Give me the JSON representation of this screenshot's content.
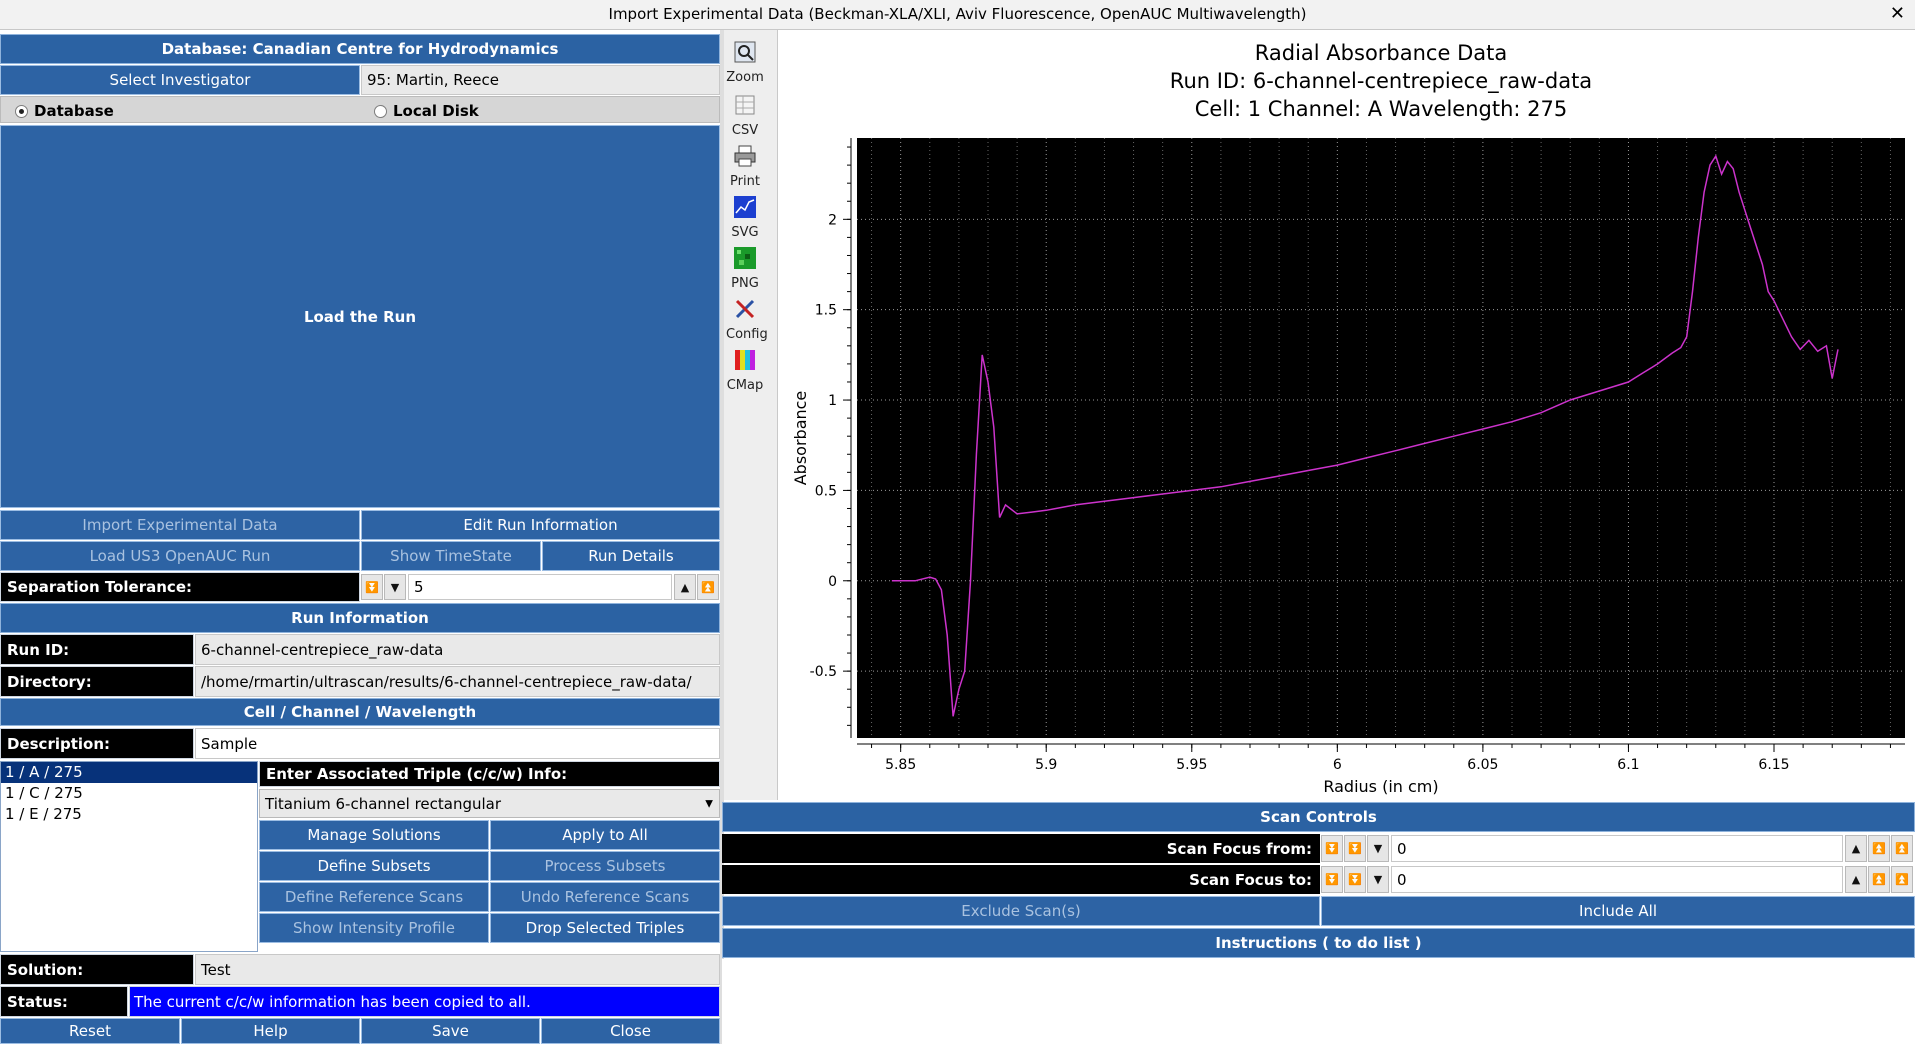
{
  "window": {
    "title": "Import Experimental Data (Beckman-XLA/XLI, Aviv Fluorescence, OpenAUC Multiwavelength)",
    "close_glyph": "✕"
  },
  "left": {
    "database_banner": "Database: Canadian Centre for Hydrodynamics",
    "select_investigator": "Select Investigator",
    "investigator_value": "95: Martin, Reece",
    "radio_database": "Database",
    "radio_local": "Local Disk",
    "load_run": "Load the Run",
    "import_data": "Import Experimental Data",
    "edit_run_info": "Edit Run Information",
    "load_openauc": "Load US3 OpenAUC Run",
    "show_timestate": "Show TimeState",
    "run_details": "Run Details",
    "sep_tol_label": "Separation Tolerance:",
    "sep_tol_value": "5",
    "run_info_banner": "Run Information",
    "run_id_label": "Run ID:",
    "run_id_value": "6-channel-centrepiece_raw-data",
    "directory_label": "Directory:",
    "directory_value": "/home/rmartin/ultrascan/results/6-channel-centrepiece_raw-data/",
    "ccw_banner": "Cell / Channel / Wavelength",
    "description_label": "Description:",
    "description_value": "Sample",
    "triples": [
      "1 / A / 275",
      "1 / C / 275",
      "1 / E / 275"
    ],
    "triple_info_label": "Enter Associated Triple (c/c/w) Info:",
    "centerpiece": "Titanium 6-channel rectangular",
    "manage_solutions": "Manage Solutions",
    "apply_to_all": "Apply to All",
    "define_subsets": "Define Subsets",
    "process_subsets": "Process Subsets",
    "define_ref_scans": "Define Reference Scans",
    "undo_ref_scans": "Undo Reference Scans",
    "show_intensity": "Show Intensity Profile",
    "drop_triples": "Drop Selected Triples",
    "solution_label": "Solution:",
    "solution_value": "Test",
    "status_label": "Status:",
    "status_value": "The current c/c/w information has been copied to all.",
    "reset": "Reset",
    "help": "Help",
    "save": "Save",
    "close": "Close"
  },
  "toolbar": {
    "items": [
      {
        "label": "Zoom",
        "icon": "zoom-icon"
      },
      {
        "label": "CSV",
        "icon": "csv-icon"
      },
      {
        "label": "Print",
        "icon": "print-icon"
      },
      {
        "label": "SVG",
        "icon": "svg-icon"
      },
      {
        "label": "PNG",
        "icon": "png-icon"
      },
      {
        "label": "Config",
        "icon": "config-icon"
      },
      {
        "label": "CMap",
        "icon": "cmap-icon"
      }
    ]
  },
  "chart_data": {
    "type": "line",
    "title": "Radial Absorbance Data",
    "subtitle": "Run ID: 6-channel-centrepiece_raw-data",
    "subtitle2": "Cell: 1  Channel: A  Wavelength: 275",
    "xlabel": "Radius (in cm)",
    "ylabel": "Absorbance",
    "xlim": [
      5.835,
      6.195
    ],
    "ylim": [
      -0.87,
      2.45
    ],
    "xticks": [
      5.85,
      5.9,
      5.95,
      6,
      6.05,
      6.1,
      6.15
    ],
    "xtick_labels": [
      "5.85",
      "5.9",
      "5.95",
      "6",
      "6.05",
      "6.1",
      "6.15"
    ],
    "yticks": [
      -0.5,
      0,
      0.5,
      1,
      1.5,
      2
    ],
    "ytick_labels": [
      "-0.5",
      "0",
      "0.5",
      "1",
      "1.5",
      "2"
    ],
    "grid": true,
    "background": "#000000",
    "line_color": "#cc33cc",
    "series": [
      {
        "x": [
          5.847,
          5.855,
          5.86,
          5.862,
          5.864,
          5.866,
          5.868,
          5.87,
          5.872,
          5.874,
          5.876,
          5.878,
          5.88,
          5.882,
          5.884,
          5.886,
          5.89,
          5.895,
          5.9,
          5.91,
          5.92,
          5.93,
          5.94,
          5.95,
          5.96,
          5.97,
          5.98,
          5.99,
          6.0,
          6.01,
          6.02,
          6.03,
          6.04,
          6.05,
          6.06,
          6.07,
          6.08,
          6.09,
          6.1,
          6.105,
          6.11,
          6.115,
          6.118,
          6.12,
          6.122,
          6.124,
          6.126,
          6.128,
          6.13,
          6.132,
          6.134,
          6.136,
          6.138,
          6.14,
          6.142,
          6.144,
          6.146,
          6.148,
          6.15,
          6.153,
          6.156,
          6.159,
          6.162,
          6.165,
          6.168,
          6.17,
          6.172
        ],
        "y": [
          0.0,
          0.0,
          0.02,
          0.01,
          -0.05,
          -0.3,
          -0.75,
          -0.6,
          -0.5,
          0.0,
          0.7,
          1.25,
          1.1,
          0.85,
          0.35,
          0.42,
          0.37,
          0.38,
          0.39,
          0.42,
          0.44,
          0.46,
          0.48,
          0.5,
          0.52,
          0.55,
          0.58,
          0.61,
          0.64,
          0.68,
          0.72,
          0.76,
          0.8,
          0.84,
          0.88,
          0.93,
          1.0,
          1.05,
          1.1,
          1.15,
          1.2,
          1.26,
          1.29,
          1.35,
          1.6,
          1.9,
          2.15,
          2.3,
          2.35,
          2.25,
          2.32,
          2.28,
          2.15,
          2.05,
          1.95,
          1.85,
          1.75,
          1.6,
          1.55,
          1.45,
          1.35,
          1.28,
          1.33,
          1.27,
          1.3,
          1.12,
          1.28
        ]
      }
    ]
  },
  "scan": {
    "banner": "Scan Controls",
    "focus_from_label": "Scan Focus from:",
    "focus_from_value": "0",
    "focus_to_label": "Scan Focus to:",
    "focus_to_value": "0",
    "exclude": "Exclude Scan(s)",
    "include_all": "Include All",
    "instructions_banner": "Instructions ( to do list )"
  }
}
